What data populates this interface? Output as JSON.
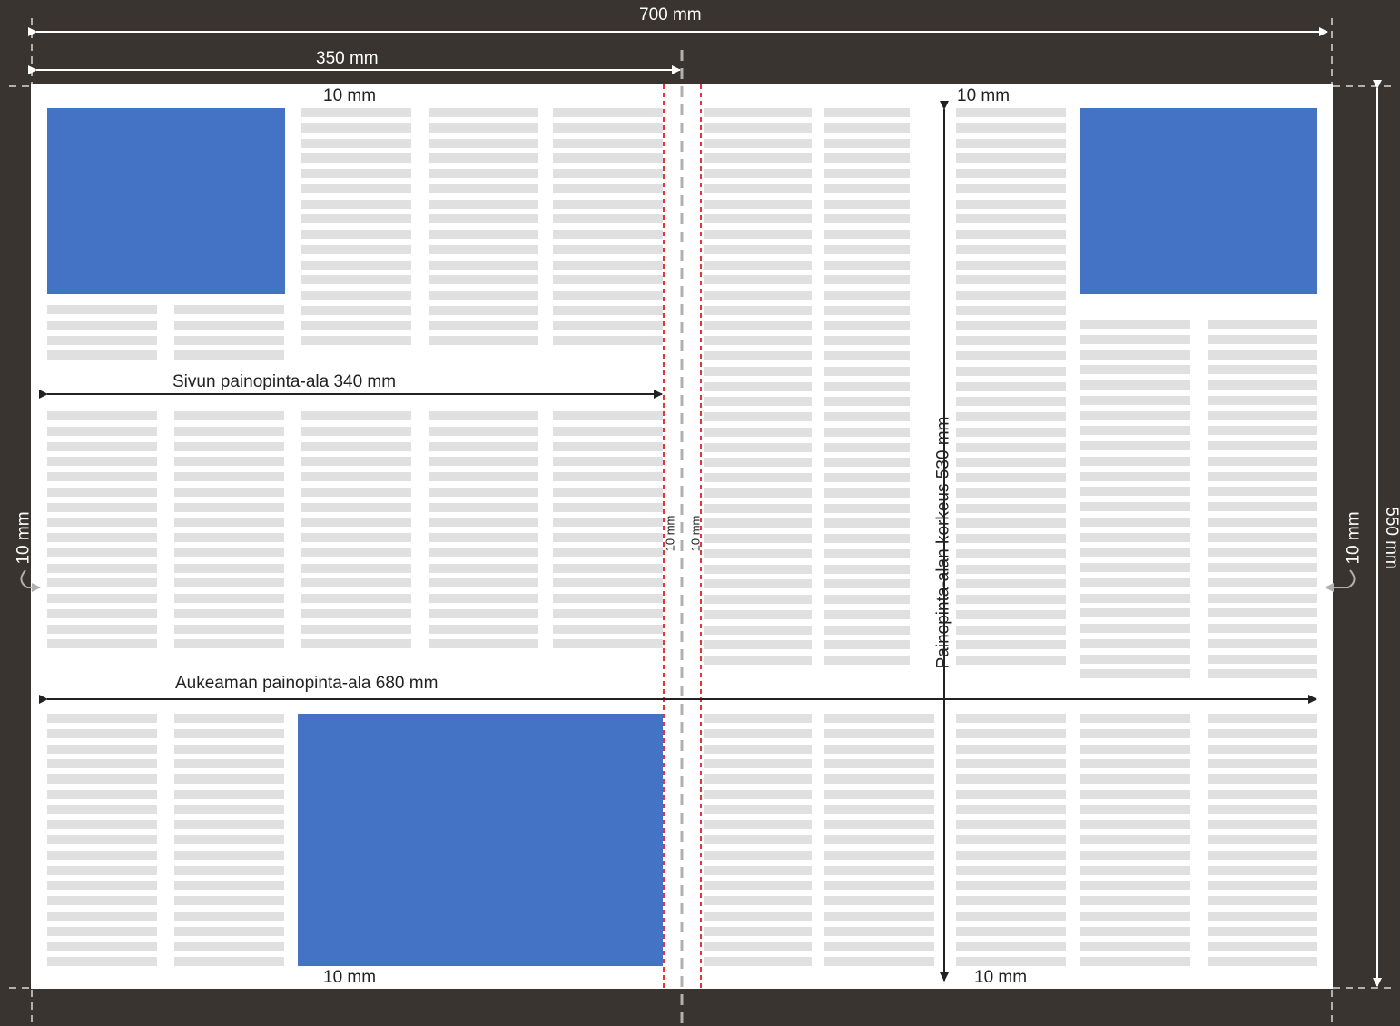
{
  "colors": {
    "background": "#3a3430",
    "page": "#ffffff",
    "image_block": "#4472c4",
    "text_line": "#e0e0e0",
    "margin_guide": "#e8333a",
    "spine_guide": "#b0b0b0",
    "arrow": "#222222",
    "outer_arrow": "#ffffff"
  },
  "dimensions": {
    "spread_width": "700 mm",
    "page_width": "350 mm",
    "spread_height": "550 mm",
    "page_print_area": "Sivun painopinta-ala 340 mm",
    "spread_print_area": "Aukeaman painopinta-ala 680 mm",
    "print_area_height": "Painopinta-alan korkeus 530 mm"
  },
  "margins": {
    "top_left": "10 mm",
    "top_right": "10 mm",
    "bottom_left": "10 mm",
    "bottom_right": "10 mm",
    "outer_left": "10 mm",
    "outer_right": "10 mm",
    "gutter_left": "10 mm",
    "gutter_right": "10 mm"
  }
}
